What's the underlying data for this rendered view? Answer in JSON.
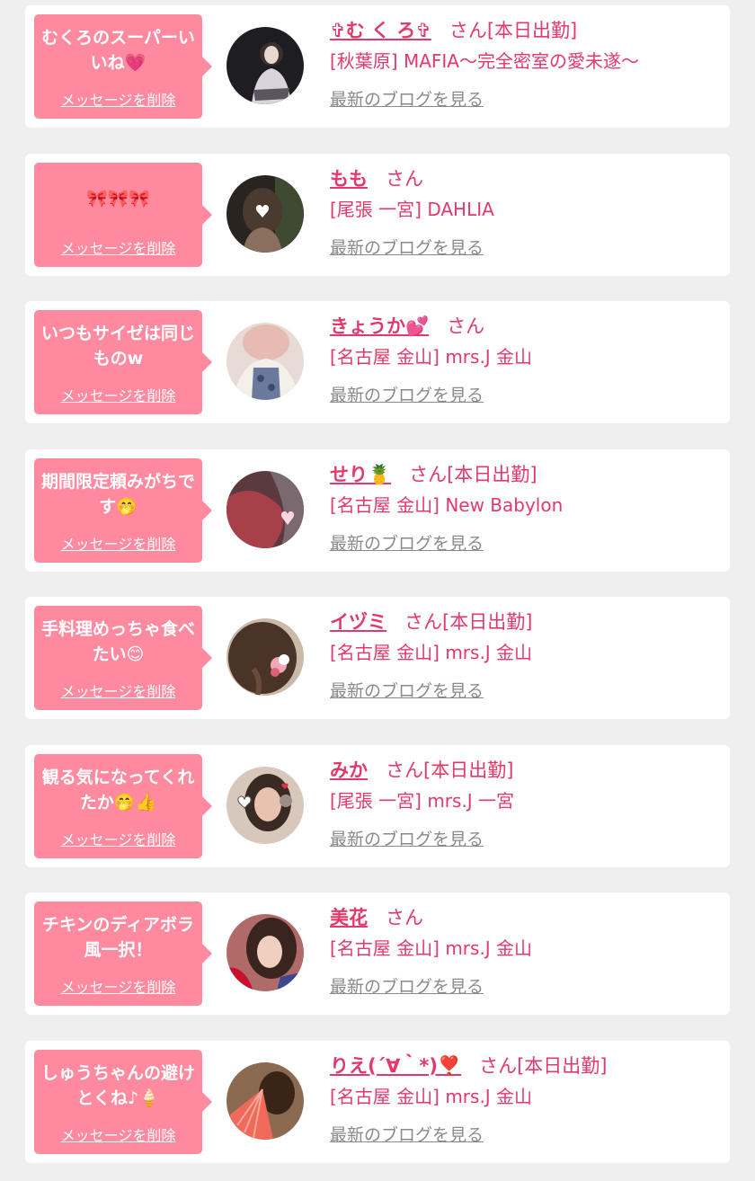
{
  "colors": {
    "page_bg": "#efefef",
    "bubble": "#ff8a9f",
    "accent": "#e2396b",
    "link_gray": "#8a8a8a"
  },
  "delete_label": "メッセージを削除",
  "blog_label": "最新のブログを見る",
  "entries": [
    {
      "message": "むくろのスーパーいいね💗",
      "name": "✞む く ろ✞",
      "suffix": "さん[本日出勤]",
      "shop": "[秋葉原] MAFIA〜完全密室の愛未遂〜",
      "avatar_icon": "person-photo"
    },
    {
      "message": "🎀🎀🎀",
      "name": "もも",
      "suffix": "さん",
      "shop": "[尾張 一宮] DAHLIA",
      "avatar_icon": "person-photo"
    },
    {
      "message": "いつもサイゼは同じものw",
      "name": "きょうか💕",
      "suffix": "さん",
      "shop": "[名古屋 金山] mrs.J 金山",
      "avatar_icon": "person-photo"
    },
    {
      "message": "期間限定頼みがちです🤭",
      "name": "せり🍍",
      "suffix": "さん[本日出勤]",
      "shop": "[名古屋 金山] New Babylon",
      "avatar_icon": "person-photo"
    },
    {
      "message": "手料理めっちゃ食べたい😊",
      "name": "イヅミ",
      "suffix": "さん[本日出勤]",
      "shop": "[名古屋 金山] mrs.J 金山",
      "avatar_icon": "person-photo"
    },
    {
      "message": "観る気になってくれたか🤭👍",
      "name": "みか",
      "suffix": "さん[本日出勤]",
      "shop": "[尾張 一宮] mrs.J 一宮",
      "avatar_icon": "person-photo"
    },
    {
      "message": "チキンのディアボラ風一択！",
      "name": "美花",
      "suffix": "さん",
      "shop": "[名古屋 金山] mrs.J 金山",
      "avatar_icon": "person-photo"
    },
    {
      "message": "しゅうちゃんの避けとくね♪🍦",
      "name": "りえ(´∀｀*)❣️",
      "suffix": "さん[本日出勤]",
      "shop": "[名古屋 金山] mrs.J 金山",
      "avatar_icon": "person-photo"
    }
  ]
}
